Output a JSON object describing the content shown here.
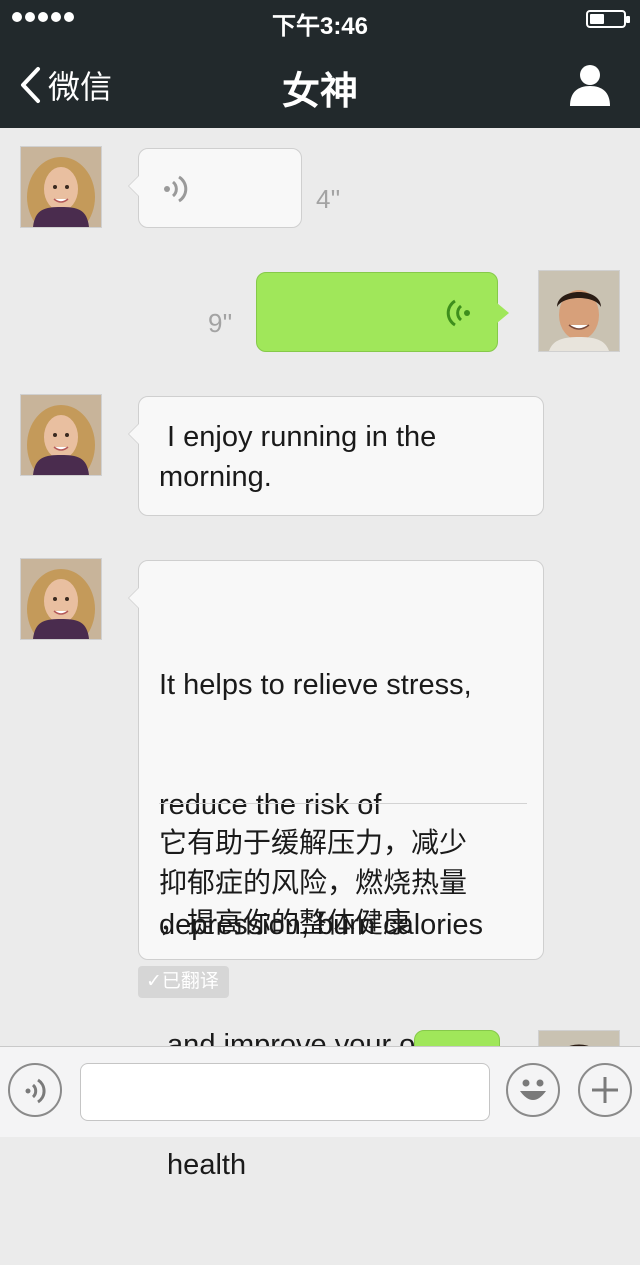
{
  "status_bar": {
    "time": "下午3:46"
  },
  "nav": {
    "back_label": "微信",
    "title": "女神"
  },
  "messages": [
    {
      "voice_duration": "4''"
    },
    {
      "voice_duration": "9''"
    },
    {
      "text_line1": " I enjoy running in the",
      "text_line2": "morning."
    },
    {
      "text_lines": [
        "It helps to relieve stress,",
        "reduce the risk of",
        "depression, burn calories",
        " and improve your overall",
        " health"
      ],
      "translation_lines": [
        "它有助于缓解压力，减少",
        "抑郁症的风险，燃烧热量",
        "，提高你的整体健康"
      ],
      "translated_badge": "已翻译"
    }
  ],
  "icons": {
    "back": "chevron-left-icon",
    "contact": "person-icon",
    "voice": "voice-wave-icon",
    "emoji": "smiley-icon",
    "add": "plus-icon"
  },
  "colors": {
    "navbar": "#22292c",
    "background": "#ebebeb",
    "sent_bubble": "#a0e75a"
  }
}
